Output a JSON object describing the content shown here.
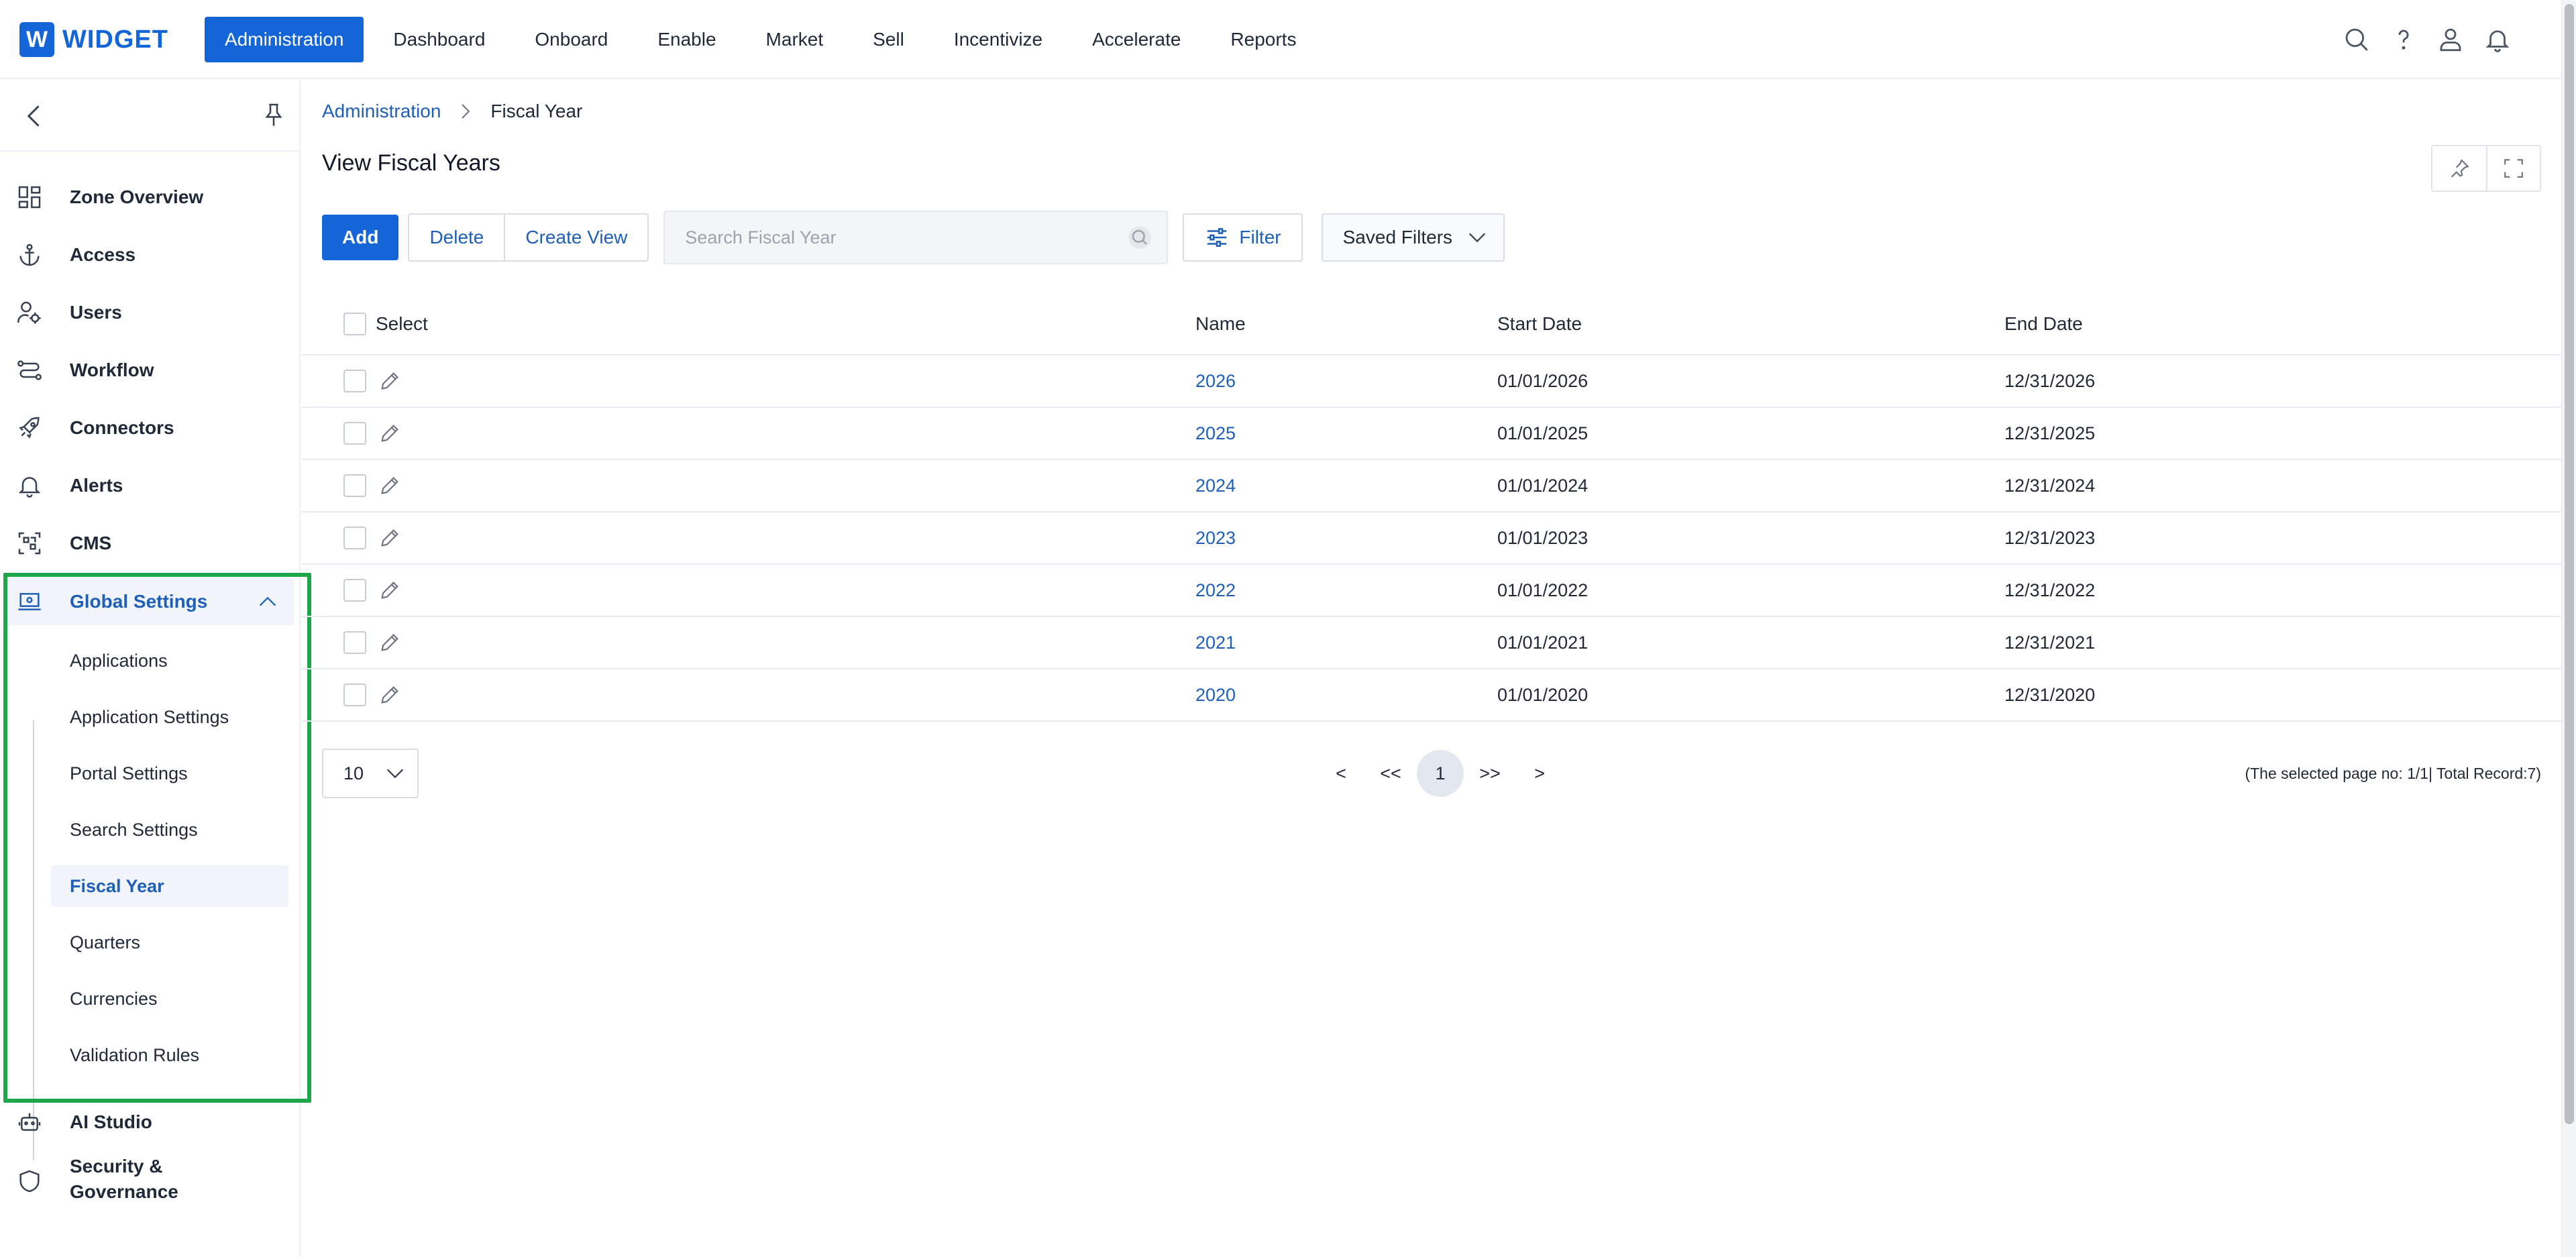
{
  "app": {
    "logo_letter": "W",
    "logo_text": "WIDGET"
  },
  "nav": {
    "items": [
      {
        "label": "Administration",
        "active": true
      },
      {
        "label": "Dashboard"
      },
      {
        "label": "Onboard"
      },
      {
        "label": "Enable"
      },
      {
        "label": "Market"
      },
      {
        "label": "Sell"
      },
      {
        "label": "Incentivize"
      },
      {
        "label": "Accelerate"
      },
      {
        "label": "Reports"
      }
    ],
    "icons": [
      "search-icon",
      "help-icon",
      "user-icon",
      "bell-icon"
    ]
  },
  "sidebar": {
    "items": [
      {
        "label": "Zone Overview",
        "icon": "grid-icon"
      },
      {
        "label": "Access",
        "icon": "anchor-icon"
      },
      {
        "label": "Users",
        "icon": "users-gear-icon"
      },
      {
        "label": "Workflow",
        "icon": "workflow-icon"
      },
      {
        "label": "Connectors",
        "icon": "rocket-icon"
      },
      {
        "label": "Alerts",
        "icon": "bell-icon"
      },
      {
        "label": "CMS",
        "icon": "cms-icon"
      },
      {
        "label": "Global Settings",
        "icon": "laptop-settings-icon",
        "expanded": true
      },
      {
        "label": "AI Studio",
        "icon": "robot-icon"
      },
      {
        "label": "Security & Governance",
        "icon": "shield-icon"
      }
    ],
    "sub_items": [
      {
        "label": "Applications"
      },
      {
        "label": "Application Settings"
      },
      {
        "label": "Portal Settings"
      },
      {
        "label": "Search Settings"
      },
      {
        "label": "Fiscal Year",
        "active": true
      },
      {
        "label": "Quarters"
      },
      {
        "label": "Currencies"
      },
      {
        "label": "Validation Rules"
      }
    ]
  },
  "breadcrumb": {
    "parent": "Administration",
    "current": "Fiscal Year"
  },
  "page": {
    "title": "View Fiscal Years"
  },
  "toolbar": {
    "add_label": "Add",
    "delete_label": "Delete",
    "create_view_label": "Create View",
    "search_placeholder": "Search Fiscal Year",
    "search_value": "",
    "filter_label": "Filter",
    "saved_filters_label": "Saved Filters"
  },
  "table": {
    "columns": {
      "select": "Select",
      "name": "Name",
      "start": "Start Date",
      "end": "End Date"
    },
    "rows": [
      {
        "name": "2026",
        "start": "01/01/2026",
        "end": "12/31/2026"
      },
      {
        "name": "2025",
        "start": "01/01/2025",
        "end": "12/31/2025"
      },
      {
        "name": "2024",
        "start": "01/01/2024",
        "end": "12/31/2024"
      },
      {
        "name": "2023",
        "start": "01/01/2023",
        "end": "12/31/2023"
      },
      {
        "name": "2022",
        "start": "01/01/2022",
        "end": "12/31/2022"
      },
      {
        "name": "2021",
        "start": "01/01/2021",
        "end": "12/31/2021"
      },
      {
        "name": "2020",
        "start": "01/01/2020",
        "end": "12/31/2020"
      }
    ]
  },
  "pagination": {
    "page_size": "10",
    "prev": "<",
    "first": "<<",
    "current_page": "1",
    "last": ">>",
    "next": ">",
    "info": "(The selected page no: 1/1| Total Record:7)"
  },
  "colors": {
    "accent": "#1466d8",
    "link": "#1e5fb8",
    "highlight": "#1da64a"
  }
}
